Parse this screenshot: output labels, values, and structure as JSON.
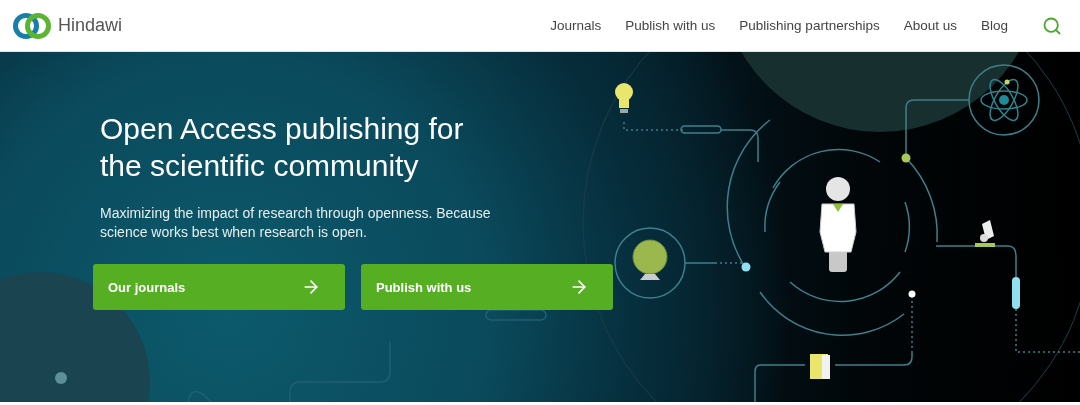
{
  "header": {
    "logo": "Hindawi",
    "nav": [
      {
        "label": "Journals"
      },
      {
        "label": "Publish with us"
      },
      {
        "label": "Publishing partnerships"
      },
      {
        "label": "About us"
      },
      {
        "label": "Blog"
      }
    ]
  },
  "hero": {
    "title": "Open Access publishing for the scientific community",
    "subtitle": "Maximizing the impact of research through openness. Because science works best when research is open.",
    "buttons": [
      {
        "label": "Our journals"
      },
      {
        "label": "Publish with us"
      }
    ]
  }
}
